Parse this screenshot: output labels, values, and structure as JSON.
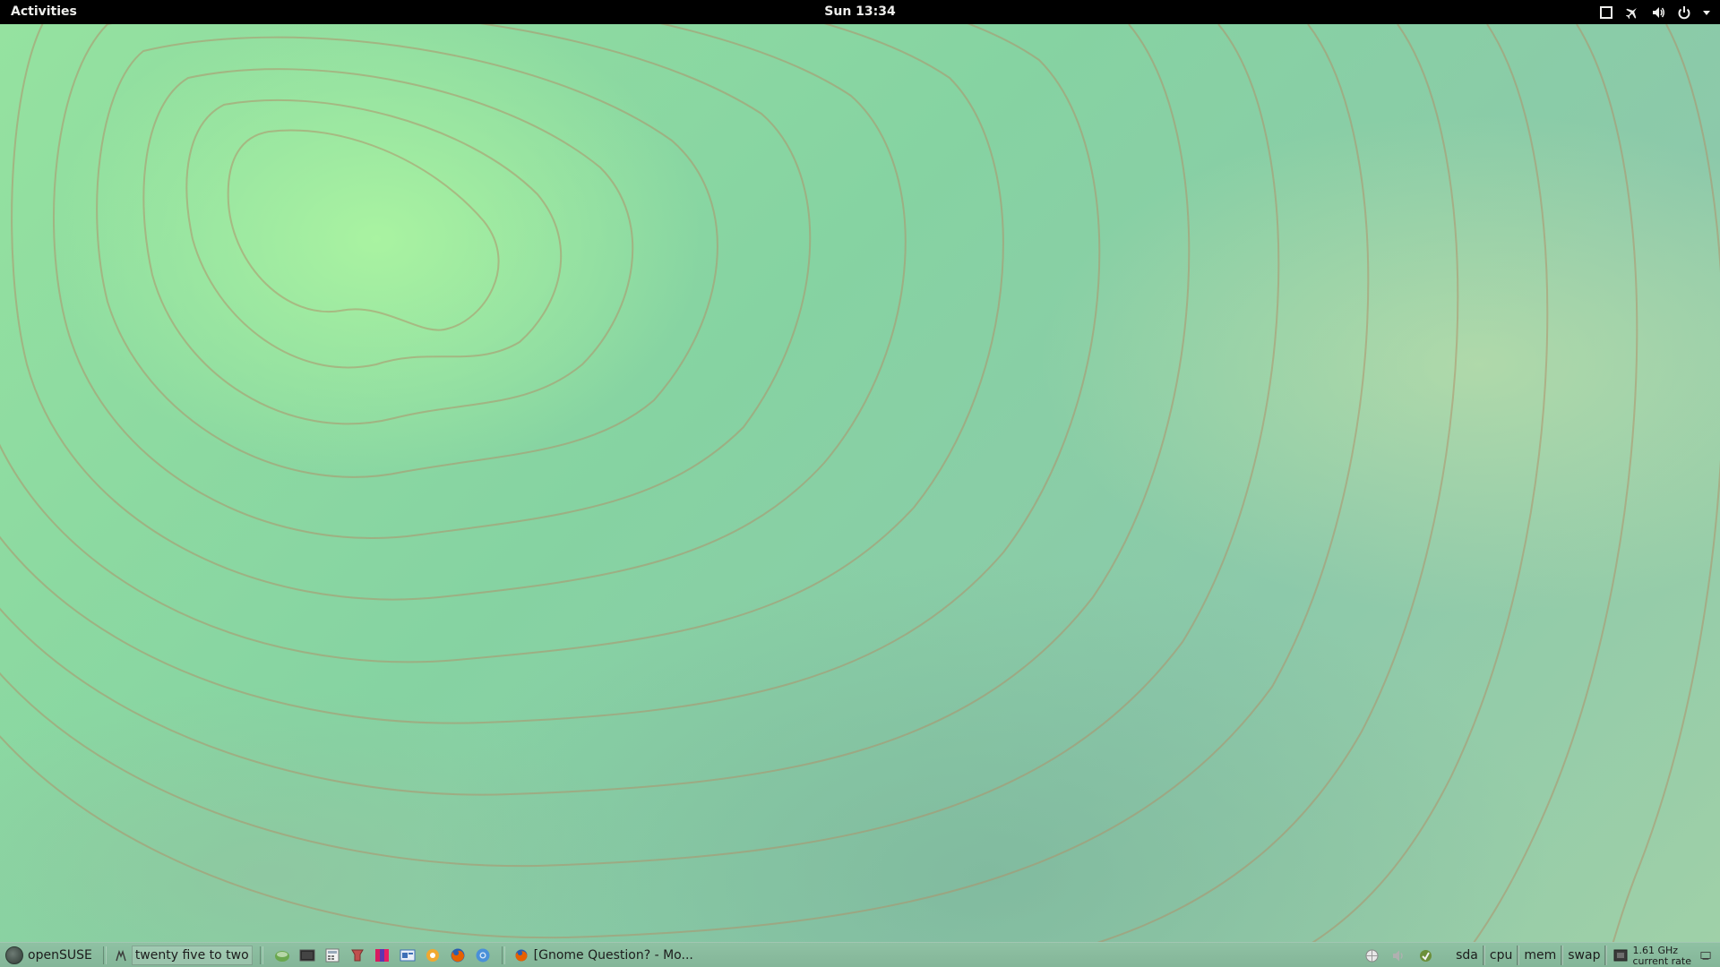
{
  "top_bar": {
    "activities_label": "Activities",
    "clock_label": "Sun 13:34",
    "status_icons": [
      "window-icon",
      "airplane-mode-icon",
      "volume-icon",
      "power-icon",
      "dropdown-arrow-icon"
    ]
  },
  "bottom_panel": {
    "menu_label": "openSUSE",
    "fuzzy_clock_label": "twenty five to two",
    "launchers": [
      "terminal-icon",
      "system-monitor-icon",
      "calculator-icon",
      "settings-icon",
      "color-palette-icon",
      "screenshot-icon",
      "media-player-icon",
      "firefox-icon",
      "chromium-icon"
    ],
    "task_label": "[Gnome Question? - Mo...",
    "tray_icons": [
      "network-icon",
      "speaker-icon",
      "updates-icon"
    ],
    "monitors": [
      "sda",
      "cpu",
      "mem",
      "swap"
    ],
    "cpu_freq_label": "1.61 GHz",
    "cpu_freq_sub": "current rate"
  },
  "colors": {
    "top_bar_bg": "#000000",
    "panel_bg": "#8fc1a3",
    "wallpaper_main": "#8cd6a2"
  }
}
